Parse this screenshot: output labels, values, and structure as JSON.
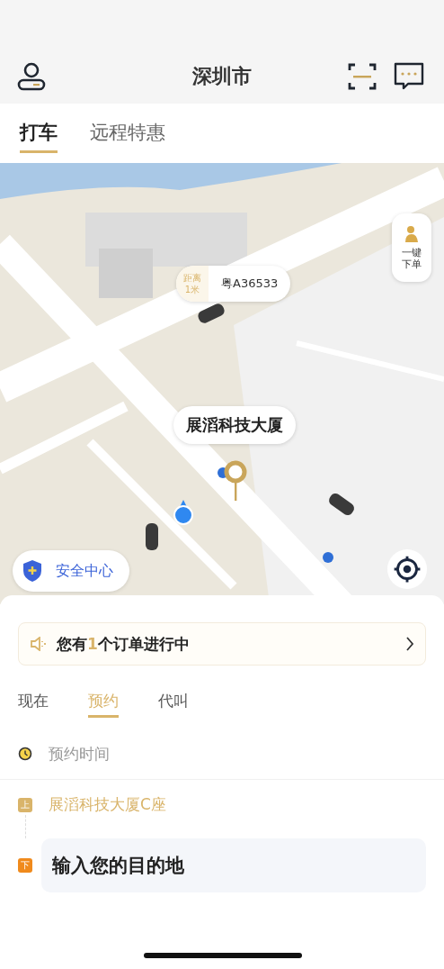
{
  "header": {
    "city": "深圳市"
  },
  "service_tabs": [
    {
      "label": "打车",
      "selected": true
    },
    {
      "label": "远程特惠",
      "selected": false
    }
  ],
  "map": {
    "plate_bubble": {
      "distance_label": "距离",
      "distance": "1米",
      "plate": "粤A36533"
    },
    "one_click": {
      "label_line_1": "一键",
      "label_line_2": "下单"
    },
    "place_callout": "展滔科技大厦",
    "safety": "安全中心"
  },
  "order_notice": {
    "prefix": "您有",
    "count": "1",
    "suffix": "个订单进行中"
  },
  "ride_modes": [
    {
      "label": "现在",
      "selected": false
    },
    {
      "label": "预约",
      "selected": true
    },
    {
      "label": "代叫",
      "selected": false
    }
  ],
  "booking_time": {
    "placeholder": "预约时间"
  },
  "pickup": {
    "marker": "上",
    "value": "展滔科技大厦C座"
  },
  "destination": {
    "marker": "下",
    "placeholder": "输入您的目的地"
  }
}
